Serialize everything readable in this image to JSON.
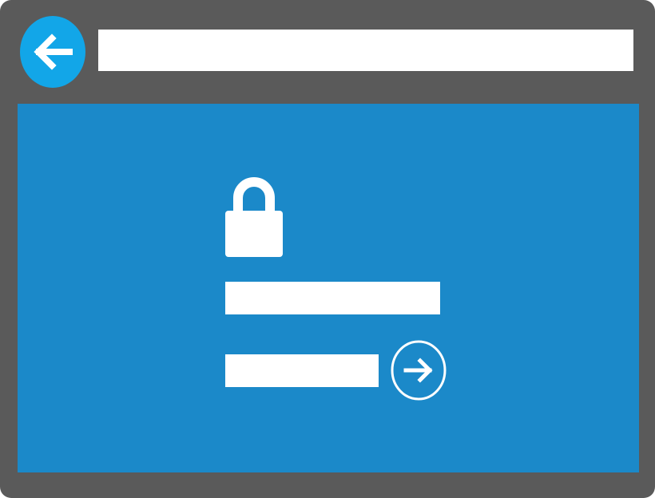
{
  "colors": {
    "frame": "#5a5a5a",
    "back_button": "#12a6e8",
    "content_background": "#1b89c9",
    "foreground": "#ffffff"
  },
  "toolbar": {
    "back_icon": "arrow-left-icon",
    "address_value": ""
  },
  "login": {
    "lock_icon": "lock-icon",
    "username_value": "",
    "password_value": "",
    "submit_icon": "arrow-right-circle-icon"
  }
}
